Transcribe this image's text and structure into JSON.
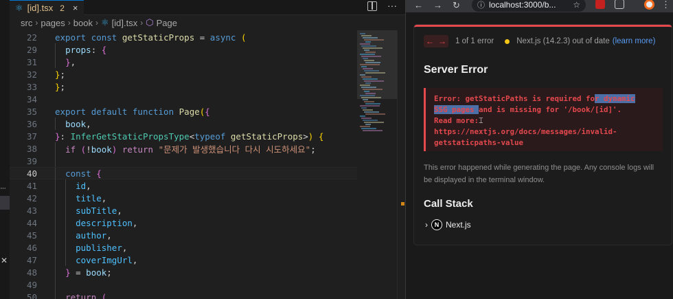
{
  "editor": {
    "tab": {
      "filename": "[id].tsx",
      "problem_count": "2",
      "close": "×"
    },
    "breadcrumb": [
      "src",
      "pages",
      "book",
      "[id].tsx",
      "Page"
    ],
    "lines": [
      {
        "n": "22",
        "html": "<span class='k'>export</span> <span class='k'>const</span> <span class='f'>getStaticProps</span> = <span class='k'>async</span> <span class='y'>(</span>"
      },
      {
        "n": "29",
        "html": "  <span class='v'>props</span>: <span class='p'>{</span>"
      },
      {
        "n": "31",
        "html": "  <span class='p'>}</span>,"
      },
      {
        "n": "32",
        "html": "<span class='y'>}</span>;"
      },
      {
        "n": "33",
        "html": "<span class='y'>}</span>;"
      },
      {
        "n": "34",
        "html": ""
      },
      {
        "n": "35",
        "html": "<span class='k'>export</span> <span class='k'>default</span> <span class='k'>function</span> <span class='f'>Page</span><span class='y'>(</span><span class='p'>{</span>"
      },
      {
        "n": "36",
        "html": "  <span class='v'>book</span>,"
      },
      {
        "n": "37",
        "html": "<span class='p'>}</span>: <span class='t'>InferGetStaticPropsType</span>&lt;<span class='k'>typeof</span> <span class='f'>getStaticProps</span>&gt;<span class='y'>)</span> <span class='y'>{</span>"
      },
      {
        "n": "38",
        "html": "  <span class='ctl'>if</span> <span class='p'>(</span>!<span class='v'>book</span><span class='p'>)</span> <span class='ctl'>return</span> <span class='s'>\"문제가 발생했습니다 다시 시도하세요\"</span>;"
      },
      {
        "n": "39",
        "html": ""
      },
      {
        "n": "40",
        "html": "  <span class='k'>const</span> <span class='p'>{</span>"
      },
      {
        "n": "41",
        "html": "    <span class='c'>id</span>,"
      },
      {
        "n": "42",
        "html": "    <span class='c'>title</span>,"
      },
      {
        "n": "43",
        "html": "    <span class='c'>subTitle</span>,"
      },
      {
        "n": "44",
        "html": "    <span class='c'>description</span>,"
      },
      {
        "n": "45",
        "html": "    <span class='c'>author</span>,"
      },
      {
        "n": "46",
        "html": "    <span class='c'>publisher</span>,"
      },
      {
        "n": "47",
        "html": "    <span class='c'>coverImgUrl</span>,"
      },
      {
        "n": "48",
        "html": "  <span class='p'>}</span> = <span class='v'>book</span>;"
      },
      {
        "n": "49",
        "html": ""
      },
      {
        "n": "50",
        "html": "  <span class='ctl'>return</span> <span class='p'>(</span>"
      }
    ],
    "current_line": "40"
  },
  "browser": {
    "url": "localhost:3000/b...",
    "error_count_text": "1 of 1 error",
    "version_text": "Next.js (14.2.3) out of date",
    "learn_more": "(learn more)",
    "title": "Server Error",
    "error_lines": [
      "Error: getStaticPaths is required for dynamic",
      "SSG pages and is missing for '/book/[id]'.",
      "Read more:",
      "https://nextjs.org/docs/messages/invalid-",
      "getstaticpaths-value"
    ],
    "description": "This error happened while generating the page. Any console logs will be displayed in the terminal window.",
    "call_stack_title": "Call Stack",
    "frame_label": "Next.js",
    "frame_logo": "N"
  },
  "colors": {
    "error_red": "#e5484d",
    "warning_yellow": "#f5c518",
    "link_blue": "#5a9cf5",
    "editor_bg": "#1f1f1f"
  }
}
